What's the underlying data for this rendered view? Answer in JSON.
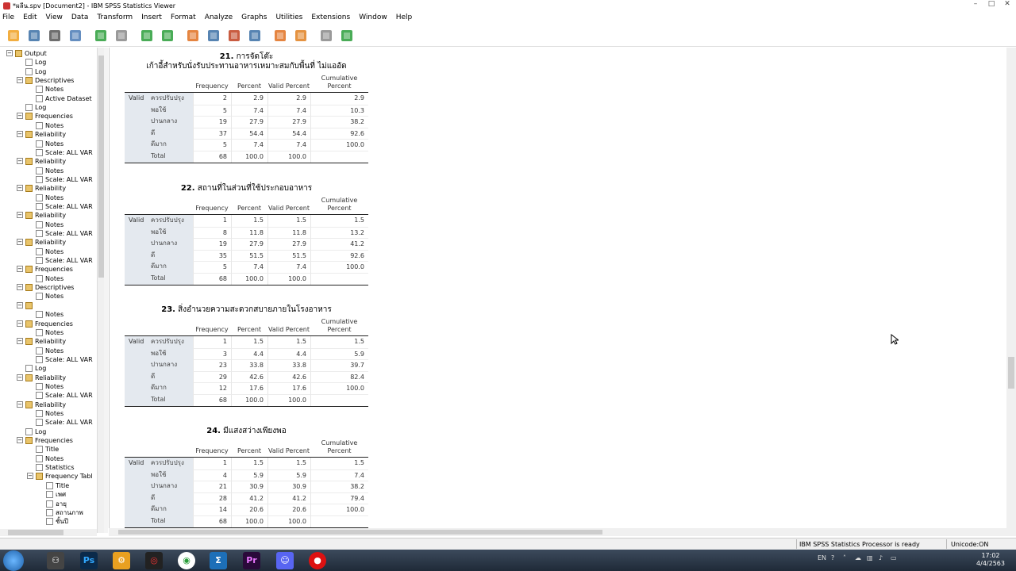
{
  "window": {
    "title": "*ผลีน.spv [Document2] - IBM SPSS Statistics Viewer",
    "minimize": "–",
    "maximize": "□",
    "close": "✕"
  },
  "menu": [
    "File",
    "Edit",
    "View",
    "Data",
    "Transform",
    "Insert",
    "Format",
    "Analyze",
    "Graphs",
    "Utilities",
    "Extensions",
    "Window",
    "Help"
  ],
  "toolbar_icons": [
    "open-icon",
    "save-icon",
    "print-icon",
    "print-preview-icon",
    "export-icon",
    "recall-dialog-icon",
    "undo-icon",
    "redo-icon",
    "goto-data-icon",
    "goto-case-icon",
    "insert-cases-icon",
    "variables-icon",
    "designate-window-icon",
    "pivot-table-icon",
    "hidden-icon",
    "insert-output-icon"
  ],
  "outline": [
    {
      "label": "Output",
      "type": "book",
      "indent": 0
    },
    {
      "label": "Log",
      "type": "page",
      "indent": 1
    },
    {
      "label": "Log",
      "type": "page",
      "indent": 1
    },
    {
      "label": "Descriptives",
      "type": "book",
      "indent": 1
    },
    {
      "label": "Notes",
      "type": "page",
      "indent": 2
    },
    {
      "label": "Active Dataset",
      "type": "page",
      "indent": 2
    },
    {
      "label": "Log",
      "type": "page",
      "indent": 1
    },
    {
      "label": "Frequencies",
      "type": "book",
      "indent": 1
    },
    {
      "label": "Notes",
      "type": "page",
      "indent": 2
    },
    {
      "label": "Reliability",
      "type": "book",
      "indent": 1
    },
    {
      "label": "Notes",
      "type": "page",
      "indent": 2
    },
    {
      "label": "Scale: ALL VAR",
      "type": "page",
      "indent": 2
    },
    {
      "label": "Reliability",
      "type": "book",
      "indent": 1
    },
    {
      "label": "Notes",
      "type": "page",
      "indent": 2
    },
    {
      "label": "Scale: ALL VAR",
      "type": "page",
      "indent": 2
    },
    {
      "label": "Reliability",
      "type": "book",
      "indent": 1
    },
    {
      "label": "Notes",
      "type": "page",
      "indent": 2
    },
    {
      "label": "Scale: ALL VAR",
      "type": "page",
      "indent": 2
    },
    {
      "label": "Reliability",
      "type": "book",
      "indent": 1
    },
    {
      "label": "Notes",
      "type": "page",
      "indent": 2
    },
    {
      "label": "Scale: ALL VAR",
      "type": "page",
      "indent": 2
    },
    {
      "label": "Reliability",
      "type": "book",
      "indent": 1
    },
    {
      "label": "Notes",
      "type": "page",
      "indent": 2
    },
    {
      "label": "Scale: ALL VAR",
      "type": "page",
      "indent": 2
    },
    {
      "label": "Frequencies",
      "type": "book",
      "indent": 1
    },
    {
      "label": "Notes",
      "type": "page",
      "indent": 2
    },
    {
      "label": "Descriptives",
      "type": "book",
      "indent": 1
    },
    {
      "label": "Notes",
      "type": "page",
      "indent": 2
    },
    {
      "label": "",
      "type": "book",
      "indent": 1
    },
    {
      "label": "Notes",
      "type": "page",
      "indent": 2
    },
    {
      "label": "Frequencies",
      "type": "book",
      "indent": 1
    },
    {
      "label": "Notes",
      "type": "page",
      "indent": 2
    },
    {
      "label": "Reliability",
      "type": "book",
      "indent": 1
    },
    {
      "label": "Notes",
      "type": "page",
      "indent": 2
    },
    {
      "label": "Scale: ALL VAR",
      "type": "page",
      "indent": 2
    },
    {
      "label": "Log",
      "type": "page",
      "indent": 1
    },
    {
      "label": "Reliability",
      "type": "book",
      "indent": 1
    },
    {
      "label": "Notes",
      "type": "page",
      "indent": 2
    },
    {
      "label": "Scale: ALL VAR",
      "type": "page",
      "indent": 2
    },
    {
      "label": "Reliability",
      "type": "book",
      "indent": 1
    },
    {
      "label": "Notes",
      "type": "page",
      "indent": 2
    },
    {
      "label": "Scale: ALL VAR",
      "type": "page",
      "indent": 2
    },
    {
      "label": "Log",
      "type": "page",
      "indent": 1
    },
    {
      "label": "Frequencies",
      "type": "book",
      "indent": 1
    },
    {
      "label": "Title",
      "type": "page",
      "indent": 2
    },
    {
      "label": "Notes",
      "type": "page",
      "indent": 2
    },
    {
      "label": "Statistics",
      "type": "page",
      "indent": 2
    },
    {
      "label": "Frequency Tabl",
      "type": "book",
      "indent": 2
    },
    {
      "label": "Title",
      "type": "page",
      "indent": 3
    },
    {
      "label": "เพศ",
      "type": "page",
      "indent": 3
    },
    {
      "label": "อายุ",
      "type": "page",
      "indent": 3
    },
    {
      "label": "สถานภาพ",
      "type": "page",
      "indent": 3
    },
    {
      "label": "ชั้นปี",
      "type": "page",
      "indent": 3
    }
  ],
  "col_headers": {
    "frequency": "Frequency",
    "percent": "Percent",
    "valid_percent": "Valid Percent",
    "cumulative_1": "Cumulative",
    "cumulative_2": "Percent"
  },
  "valid_label": "Valid",
  "tables": [
    {
      "number": "21.",
      "title_line1": "การจัดโต๊ะ",
      "title_line2": "เก้าอี้สำหรับนั่งรับประทานอาหารเหมาะสมกับพื้นที่ ไม่แออัด",
      "rows": [
        {
          "label": "ควรปรับปรุง",
          "f": "2",
          "p": "2.9",
          "vp": "2.9",
          "cp": "2.9"
        },
        {
          "label": "พอใช้",
          "f": "5",
          "p": "7.4",
          "vp": "7.4",
          "cp": "10.3"
        },
        {
          "label": "ปานกลาง",
          "f": "19",
          "p": "27.9",
          "vp": "27.9",
          "cp": "38.2"
        },
        {
          "label": "ดี",
          "f": "37",
          "p": "54.4",
          "vp": "54.4",
          "cp": "92.6"
        },
        {
          "label": "ดีมาก",
          "f": "5",
          "p": "7.4",
          "vp": "7.4",
          "cp": "100.0"
        },
        {
          "label": "Total",
          "f": "68",
          "p": "100.0",
          "vp": "100.0",
          "cp": ""
        }
      ]
    },
    {
      "number": "22.",
      "title_line1": "สถานที่ในส่วนที่ใช้ประกอบอาหาร",
      "title_line2": "",
      "rows": [
        {
          "label": "ควรปรับปรุง",
          "f": "1",
          "p": "1.5",
          "vp": "1.5",
          "cp": "1.5"
        },
        {
          "label": "พอใช้",
          "f": "8",
          "p": "11.8",
          "vp": "11.8",
          "cp": "13.2"
        },
        {
          "label": "ปานกลาง",
          "f": "19",
          "p": "27.9",
          "vp": "27.9",
          "cp": "41.2"
        },
        {
          "label": "ดี",
          "f": "35",
          "p": "51.5",
          "vp": "51.5",
          "cp": "92.6"
        },
        {
          "label": "ดีมาก",
          "f": "5",
          "p": "7.4",
          "vp": "7.4",
          "cp": "100.0"
        },
        {
          "label": "Total",
          "f": "68",
          "p": "100.0",
          "vp": "100.0",
          "cp": ""
        }
      ]
    },
    {
      "number": "23.",
      "title_line1": "สิ่งอำนวยความสะดวกสบายภายในโรงอาหาร",
      "title_line2": "",
      "rows": [
        {
          "label": "ควรปรับปรุง",
          "f": "1",
          "p": "1.5",
          "vp": "1.5",
          "cp": "1.5"
        },
        {
          "label": "พอใช้",
          "f": "3",
          "p": "4.4",
          "vp": "4.4",
          "cp": "5.9"
        },
        {
          "label": "ปานกลาง",
          "f": "23",
          "p": "33.8",
          "vp": "33.8",
          "cp": "39.7"
        },
        {
          "label": "ดี",
          "f": "29",
          "p": "42.6",
          "vp": "42.6",
          "cp": "82.4"
        },
        {
          "label": "ดีมาก",
          "f": "12",
          "p": "17.6",
          "vp": "17.6",
          "cp": "100.0"
        },
        {
          "label": "Total",
          "f": "68",
          "p": "100.0",
          "vp": "100.0",
          "cp": ""
        }
      ]
    },
    {
      "number": "24.",
      "title_line1": "มีแสงสว่างเพียงพอ",
      "title_line2": "",
      "rows": [
        {
          "label": "ควรปรับปรุง",
          "f": "1",
          "p": "1.5",
          "vp": "1.5",
          "cp": "1.5"
        },
        {
          "label": "พอใช้",
          "f": "4",
          "p": "5.9",
          "vp": "5.9",
          "cp": "7.4"
        },
        {
          "label": "ปานกลาง",
          "f": "21",
          "p": "30.9",
          "vp": "30.9",
          "cp": "38.2"
        },
        {
          "label": "ดี",
          "f": "28",
          "p": "41.2",
          "vp": "41.2",
          "cp": "79.4"
        },
        {
          "label": "ดีมาก",
          "f": "14",
          "p": "20.6",
          "vp": "20.6",
          "cp": "100.0"
        },
        {
          "label": "Total",
          "f": "68",
          "p": "100.0",
          "vp": "100.0",
          "cp": ""
        }
      ]
    }
  ],
  "status": {
    "processor": "IBM SPSS Statistics Processor is ready",
    "unicode": "Unicode:ON"
  },
  "taskbar": {
    "lang": "EN",
    "time": "17:02",
    "date": "4/4/2563"
  }
}
